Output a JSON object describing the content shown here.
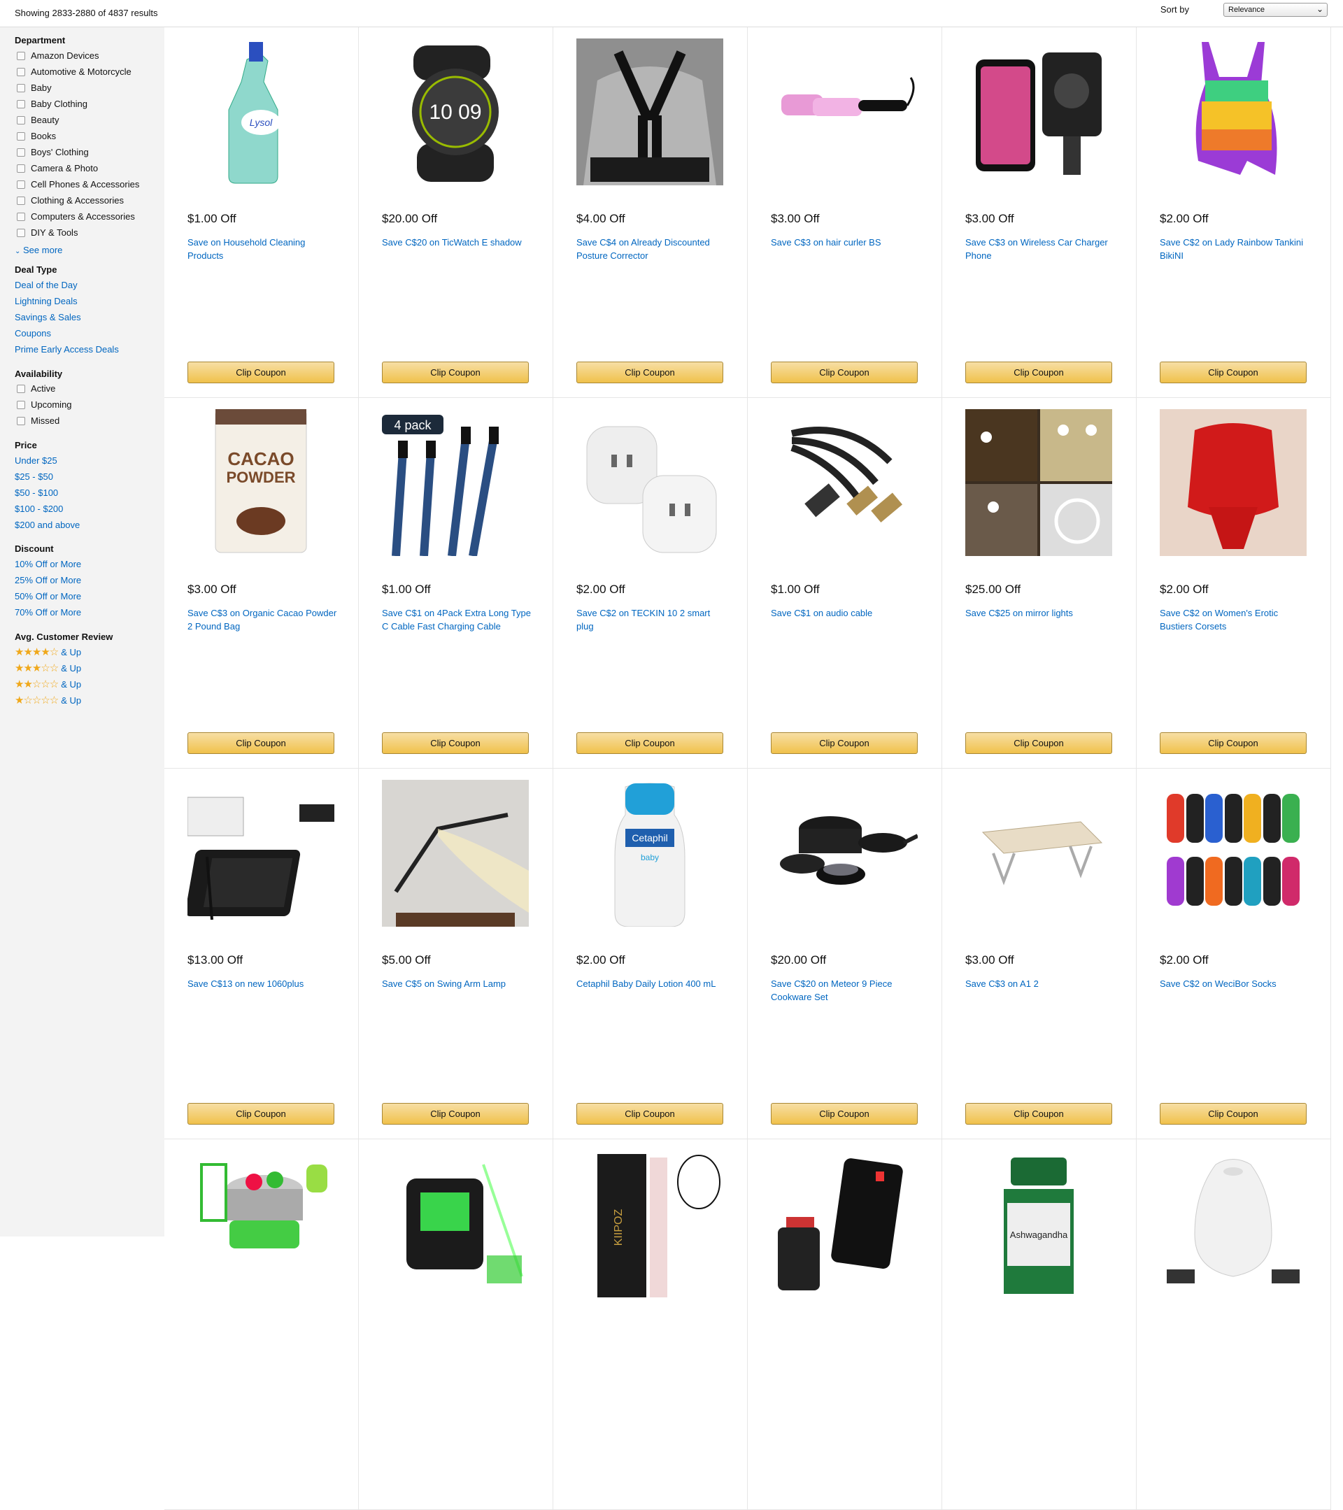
{
  "topbar": {
    "result_count": "Showing 2833-2880 of 4837 results",
    "sort_label": "Sort by",
    "sort_value": "Relevance"
  },
  "sidebar": {
    "department": {
      "title": "Department",
      "items": [
        "Amazon Devices",
        "Automotive & Motorcycle",
        "Baby",
        "Baby Clothing",
        "Beauty",
        "Books",
        "Boys' Clothing",
        "Camera & Photo",
        "Cell Phones & Accessories",
        "Clothing & Accessories",
        "Computers & Accessories",
        "DIY & Tools"
      ],
      "see_more": "See more"
    },
    "deal_type": {
      "title": "Deal Type",
      "items": [
        "Deal of the Day",
        "Lightning Deals",
        "Savings & Sales",
        "Coupons",
        "Prime Early Access Deals"
      ]
    },
    "availability": {
      "title": "Availability",
      "items": [
        "Active",
        "Upcoming",
        "Missed"
      ]
    },
    "price": {
      "title": "Price",
      "items": [
        "Under $25",
        "$25 - $50",
        "$50 - $100",
        "$100 - $200",
        "$200 and above"
      ]
    },
    "discount": {
      "title": "Discount",
      "items": [
        "10% Off or More",
        "25% Off or More",
        "50% Off or More",
        "70% Off or More"
      ]
    },
    "review": {
      "title": "Avg. Customer Review",
      "items": [
        {
          "stars": 4,
          "label": "& Up"
        },
        {
          "stars": 3,
          "label": "& Up"
        },
        {
          "stars": 2,
          "label": "& Up"
        },
        {
          "stars": 1,
          "label": "& Up"
        }
      ]
    }
  },
  "colors": {
    "link": "#0066c0",
    "button_top": "#f7dfa5",
    "button_bottom": "#f0c14b",
    "star": "#f0a81a"
  },
  "products": [
    {
      "price": "$1.00 Off",
      "title": "Save on Household Cleaning Products",
      "button": "Clip Coupon",
      "icon": "cleaner-bottle"
    },
    {
      "price": "$20.00 Off",
      "title": "Save C$20 on TicWatch E shadow",
      "button": "Clip Coupon",
      "icon": "smartwatch"
    },
    {
      "price": "$4.00 Off",
      "title": "Save C$4 on Already Discounted Posture Corrector",
      "button": "Clip Coupon",
      "icon": "posture-corrector"
    },
    {
      "price": "$3.00 Off",
      "title": "Save C$3 on hair curler BS",
      "button": "Clip Coupon",
      "icon": "hair-curler"
    },
    {
      "price": "$3.00 Off",
      "title": "Save C$3 on Wireless Car Charger Phone",
      "button": "Clip Coupon",
      "icon": "car-charger"
    },
    {
      "price": "$2.00 Off",
      "title": "Save C$2 on Lady Rainbow Tankini BikiNI",
      "button": "Clip Coupon",
      "icon": "swimsuit"
    },
    {
      "price": "$3.00 Off",
      "title": "Save C$3 on Organic Cacao Powder 2 Pound Bag",
      "button": "Clip Coupon",
      "icon": "cacao-bag"
    },
    {
      "price": "$1.00 Off",
      "title": "Save C$1 on 4Pack Extra Long Type C Cable Fast Charging Cable",
      "button": "Clip Coupon",
      "icon": "usb-cables"
    },
    {
      "price": "$2.00 Off",
      "title": "Save C$2 on TECKIN 10 2 smart plug",
      "button": "Clip Coupon",
      "icon": "smart-plug"
    },
    {
      "price": "$1.00 Off",
      "title": "Save C$1 on audio cable",
      "button": "Clip Coupon",
      "icon": "audio-cable"
    },
    {
      "price": "$25.00 Off",
      "title": "Save C$25 on mirror lights",
      "button": "Clip Coupon",
      "icon": "mirror-lights"
    },
    {
      "price": "$2.00 Off",
      "title": "Save C$2 on Women's Erotic Bustiers Corsets",
      "button": "Clip Coupon",
      "icon": "corset"
    },
    {
      "price": "$13.00 Off",
      "title": "Save C$13 on new 1060plus",
      "button": "Clip Coupon",
      "icon": "drawing-tablet"
    },
    {
      "price": "$5.00 Off",
      "title": "Save C$5 on Swing Arm Lamp",
      "button": "Clip Coupon",
      "icon": "desk-lamp"
    },
    {
      "price": "$2.00 Off",
      "title": "Cetaphil Baby Daily Lotion 400 mL",
      "button": "Clip Coupon",
      "icon": "lotion-bottle"
    },
    {
      "price": "$20.00 Off",
      "title": "Save C$20 on Meteor 9 Piece Cookware Set",
      "button": "Clip Coupon",
      "icon": "cookware"
    },
    {
      "price": "$3.00 Off",
      "title": "Save C$3 on A1 2",
      "button": "Clip Coupon",
      "icon": "laptop-tray"
    },
    {
      "price": "$2.00 Off",
      "title": "Save C$2 on WeciBor Socks",
      "button": "Clip Coupon",
      "icon": "socks"
    },
    {
      "icon": "steamer-basket"
    },
    {
      "icon": "laser-level"
    },
    {
      "icon": "razor-kit"
    },
    {
      "icon": "power-bank"
    },
    {
      "icon": "supplement-bottle"
    },
    {
      "icon": "diffuser"
    }
  ]
}
